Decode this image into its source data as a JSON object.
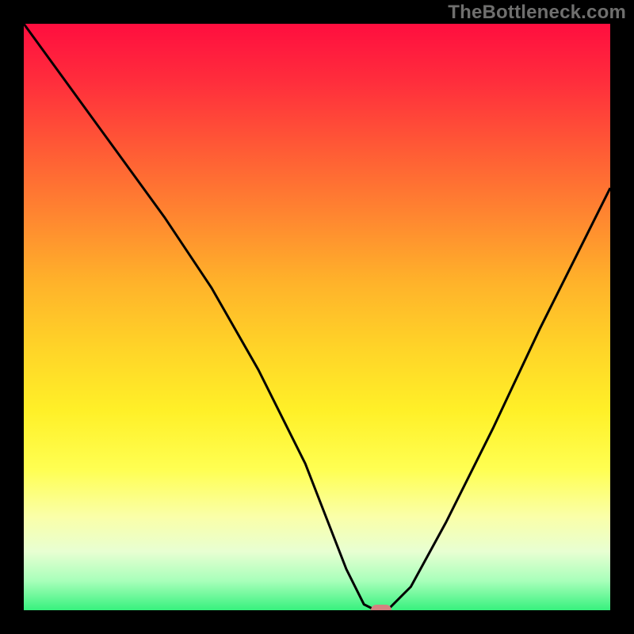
{
  "attribution": "TheBottleneck.com",
  "colors": {
    "frame": "#000000",
    "gradient_top": "#ff0e3f",
    "gradient_bottom": "#37f17e",
    "curve": "#000000",
    "marker": "#d48280",
    "attribution_text": "#6f6f6e"
  },
  "chart_data": {
    "type": "line",
    "title": "",
    "xlabel": "",
    "ylabel": "",
    "xlim": [
      0,
      100
    ],
    "ylim": [
      0,
      100
    ],
    "grid": false,
    "legend": false,
    "series": [
      {
        "name": "bottleneck-curve",
        "x": [
          0,
          8,
          16,
          24,
          32,
          40,
          48,
          55,
          58,
          60,
          62,
          66,
          72,
          80,
          88,
          96,
          100
        ],
        "values": [
          100,
          89,
          78,
          67,
          55,
          41,
          25,
          7,
          1,
          0,
          0,
          4,
          15,
          31,
          48,
          64,
          72
        ]
      }
    ],
    "annotations": [
      {
        "name": "bottleneck-marker",
        "x": 61,
        "y": 0
      }
    ]
  }
}
